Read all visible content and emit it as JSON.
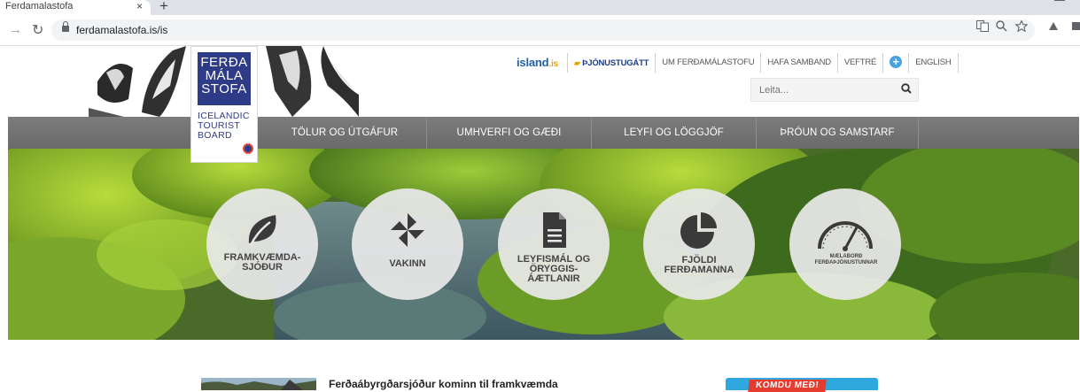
{
  "browser": {
    "tab_title": "Ferdamalastofa",
    "close_glyph": "×",
    "new_tab_glyph": "+",
    "url": "ferdamalastofa.is/is",
    "icons": [
      "forward-arrow-icon",
      "reload-icon",
      "lock-icon",
      "translate-icon",
      "zoom-icon",
      "bookmark-star-icon",
      "extension-icon"
    ]
  },
  "header": {
    "logo": {
      "lines": [
        "FERÐA",
        "MÁLA",
        "STOFA"
      ],
      "sub_lines": [
        "ICELANDIC",
        "TOURIST",
        "BOARD"
      ]
    },
    "top_links": {
      "island": "island",
      "island_suffix": ".is",
      "portal": "ÞJÓNUSTUGÁTT",
      "about": "UM FERÐAMÁLASTOFU",
      "contact": "HAFA SAMBAND",
      "sitemap": "VEFTRÉ",
      "plus": "+",
      "english": "ENGLISH"
    },
    "search": {
      "placeholder": "Leita..."
    }
  },
  "nav": {
    "items": [
      "TÖLUR OG ÚTGÁFUR",
      "UMHVERFI OG GÆÐI",
      "LEYFI OG LÖGGJÖF",
      "ÞRÓUN OG SAMSTARF"
    ]
  },
  "hero": {
    "circles": [
      {
        "label": "FRAMKVÆMDA-SJÓÐUR",
        "icon": "leaf-icon"
      },
      {
        "label": "VAKINN",
        "icon": "pinwheel-icon"
      },
      {
        "label": "LEYFISMÁL OG ÖRYGGIS-ÁÆTLANIR",
        "icon": "document-icon"
      },
      {
        "label": "FJÖLDI FERÐAMANNA",
        "icon": "pie-chart-icon"
      },
      {
        "label": "MÆLABORÐ FERÐAÞJÓNUSTUNNAR",
        "icon": "gauge-icon"
      }
    ]
  },
  "content": {
    "news_title": "Ferðaábyrgðarsjóður kominn til framkvæmda",
    "promo_label": "KOMDU MEÐ!"
  },
  "colors": {
    "brand_blue": "#2e3b86",
    "nav_gray": "#737373",
    "promo_blue": "#2fa8e0",
    "promo_red": "#e63c2f"
  }
}
